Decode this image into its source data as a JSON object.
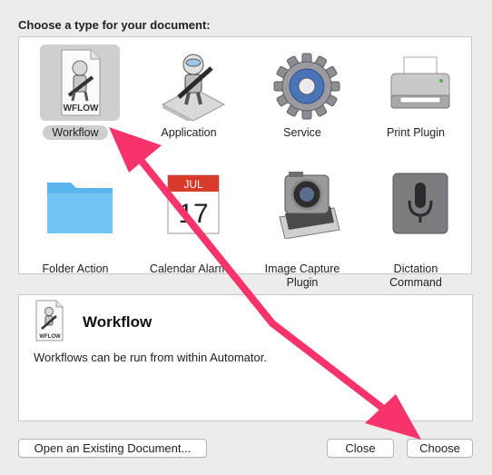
{
  "heading": "Choose a type for your document:",
  "types": [
    {
      "label": "Workflow",
      "icon": "workflow-document-icon",
      "selected": true
    },
    {
      "label": "Application",
      "icon": "automator-robot-icon",
      "selected": false
    },
    {
      "label": "Service",
      "icon": "gear-icon",
      "selected": false
    },
    {
      "label": "Print Plugin",
      "icon": "printer-icon",
      "selected": false
    },
    {
      "label": "Folder Action",
      "icon": "folder-icon",
      "selected": false
    },
    {
      "label": "Calendar Alarm",
      "icon": "calendar-icon",
      "selected": false
    },
    {
      "label": "Image Capture Plugin",
      "icon": "camera-icon",
      "selected": false
    },
    {
      "label": "Dictation Command",
      "icon": "microphone-icon",
      "selected": false
    }
  ],
  "workflow_icon_badge": "WFLOW",
  "calendar_month": "JUL",
  "calendar_day": "17",
  "description": {
    "title": "Workflow",
    "badge": "WFLOW",
    "text": "Workflows can be run from within Automator."
  },
  "buttons": {
    "open_existing": "Open an Existing Document...",
    "close": "Close",
    "choose": "Choose"
  },
  "colors": {
    "annotation_arrow": "#f7336b",
    "selection": "#cfcfcf"
  }
}
